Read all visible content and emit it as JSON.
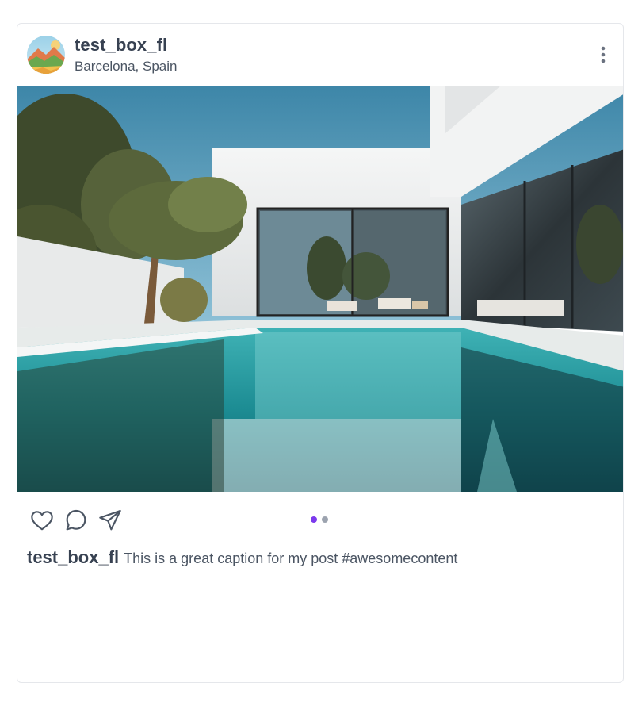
{
  "post": {
    "username": "test_box_fl",
    "location": "Barcelona, Spain",
    "caption_user": "test_box_fl",
    "caption_text": "This is a great caption for my post #awesomecontent"
  },
  "icons": {
    "more": "more-vertical-icon",
    "like": "heart-icon",
    "comment": "comment-bubble-icon",
    "share": "send-icon"
  },
  "carousel": {
    "total": 2,
    "active_index": 0
  },
  "colors": {
    "text_primary": "#374151",
    "text_secondary": "#4b5563",
    "dot_active": "#7c3aed",
    "dot_inactive": "#9ca3af",
    "border": "#e5e7eb"
  }
}
